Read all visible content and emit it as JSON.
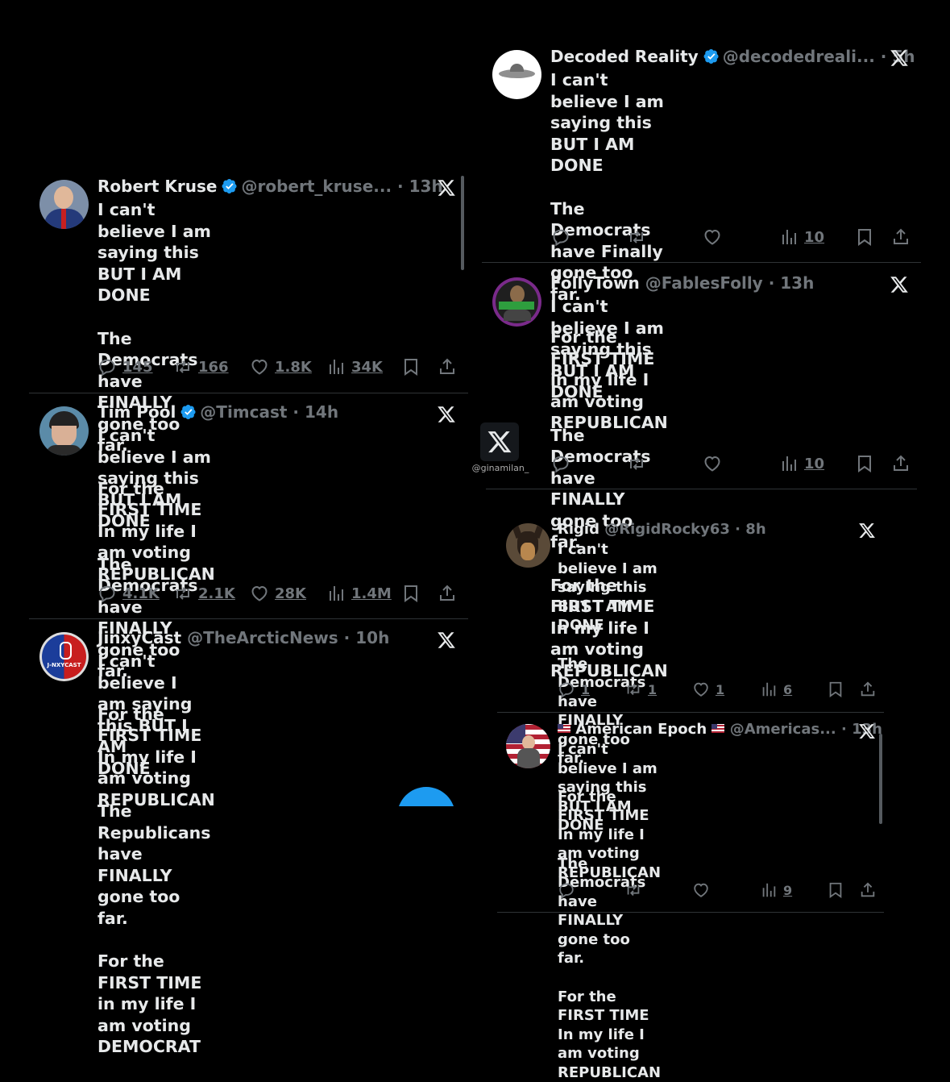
{
  "watermark": {
    "handle": "@ginamilan_",
    "icon": "x-logo-icon"
  },
  "tweets": [
    {
      "name": "Robert Kruse",
      "verified": true,
      "handle": "@robert_kruse...",
      "dot": "·",
      "time": "13h",
      "line1": "I can't believe I am saying this BUT I AM\nDONE",
      "line2": "The Democrats have FINALLY gone too far.",
      "line3": "For the FIRST TIME In my life I am voting\nREPUBLICAN",
      "replies": "145",
      "reposts": "166",
      "likes": "1.8K",
      "views": "34K"
    },
    {
      "name": "Tim Pool",
      "verified": true,
      "handle": "@Timcast",
      "dot": "·",
      "time": "14h",
      "line1": "I can't believe I am saying this BUT I AM\nDONE",
      "line2": "The Democrats have FINALLY gone too far.",
      "line3": "For the FIRST TIME In my life I am voting\nREPUBLICAN",
      "replies": "4.1K",
      "reposts": "2.1K",
      "likes": "28K",
      "views": "1.4M"
    },
    {
      "name": "JinxyCast",
      "verified": false,
      "handle": "@TheArcticNews",
      "dot": "·",
      "time": "10h",
      "avatar_text": "J-NXYCAST",
      "line1": "I can't believe I am saying this BUT I AM\nDONE",
      "line2": "The Republicans have FINALLY gone too far.",
      "line3": "For the FIRST TIME in my life I am voting\nDEMOCRAT"
    },
    {
      "name": "Decoded Reality",
      "verified": true,
      "handle": "@decodedreali...",
      "dot": "·",
      "time": "5h",
      "line1": "I can't believe I am saying this BUT I AM\nDONE",
      "line2": "The Democrats have Finally gone too far.",
      "line3": "For the FIRST TIME in my life I am voting\nREPUBLICAN",
      "views": "10"
    },
    {
      "name": "FollyTown",
      "verified": false,
      "handle": "@FablesFolly",
      "dot": "·",
      "time": "13h",
      "line1": "I can't believe I am saying this BUT I AM\nDONE",
      "line2": "The Democrats have FINALLY gone too far.",
      "line3": "For the FIRST TIME In my life I am voting\nREPUBLICAN",
      "views": "10"
    },
    {
      "name": "Rigid",
      "verified": false,
      "handle": "@RigidRocky63",
      "dot": "·",
      "time": "8h",
      "line1": "I can't believe I am saying this BUT I AM\nDONE",
      "line2": "The Democrats have FINALLY gone too far.",
      "line3": "For the FIRST TIME In my life I am voting\nREPUBLICAN",
      "replies": "1",
      "reposts": "1",
      "likes": "1",
      "views": "6"
    },
    {
      "name": "American Epoch",
      "verified": false,
      "handle": "@Americas...",
      "dot": "·",
      "time": "13h",
      "line1": "I can't believe I am saying this BUT I AM\nDONE",
      "line2": "The Democrats have FINALLY gone too far.",
      "line3": "For the FIRST TIME In my life I am voting\nREPUBLICAN",
      "views": "9"
    }
  ],
  "colors": {
    "background": "#000000",
    "text": "#e7e9ea",
    "muted": "#71767b",
    "verified": "#1d9bf0",
    "divider": "#2f3336"
  }
}
